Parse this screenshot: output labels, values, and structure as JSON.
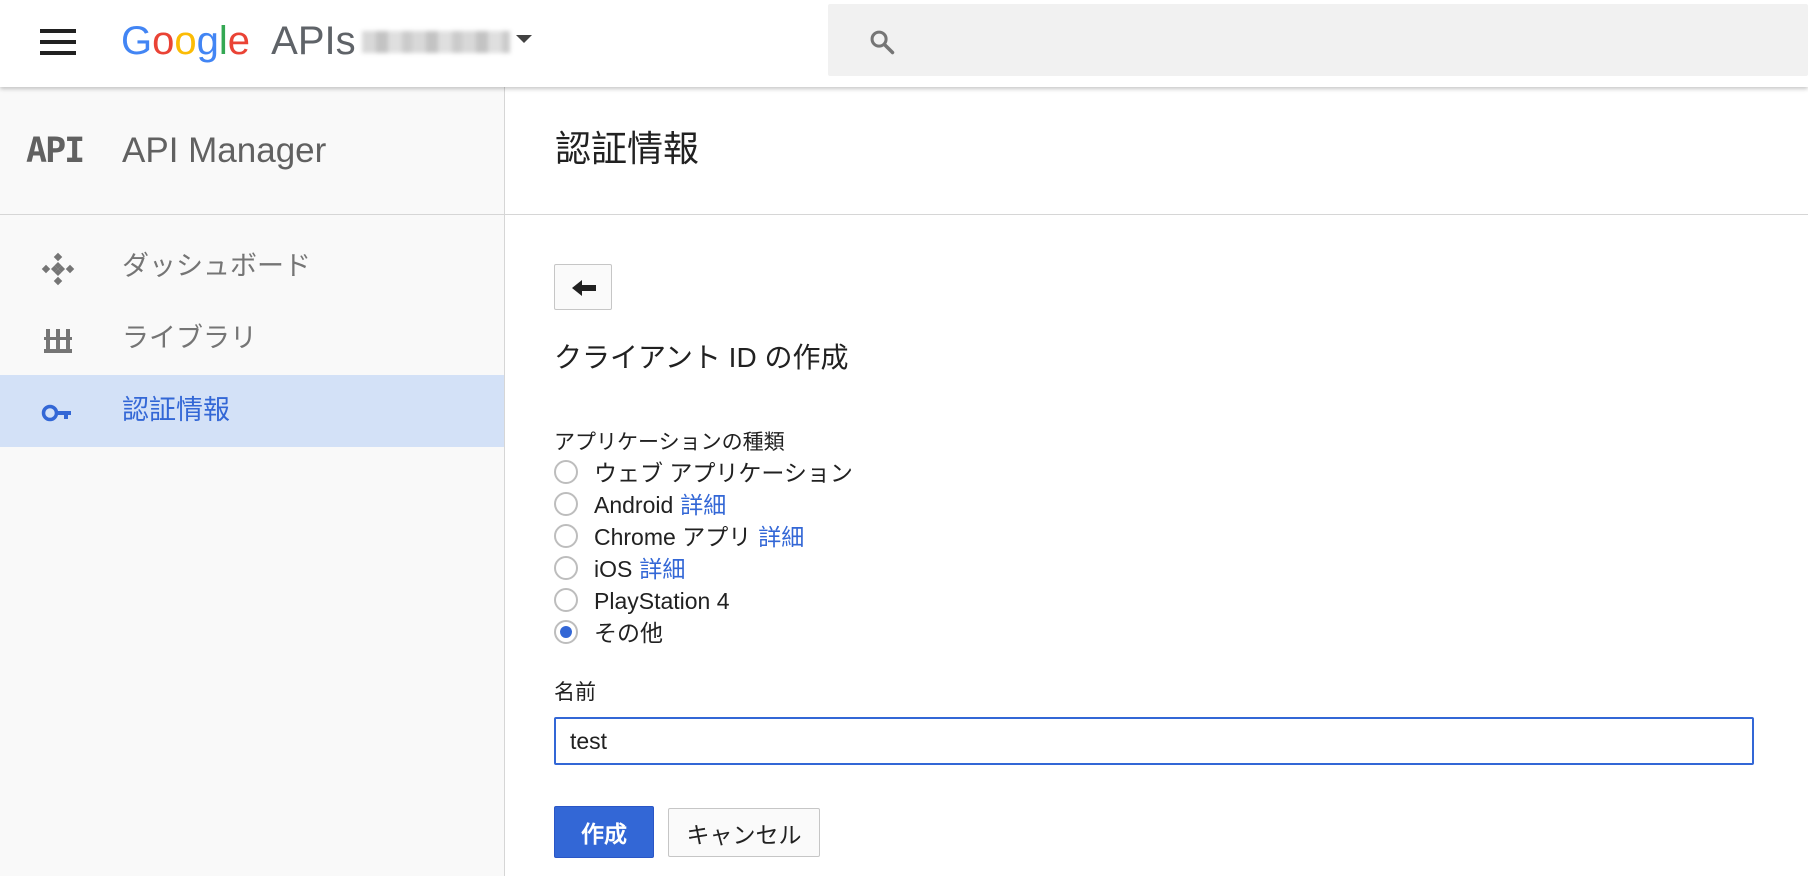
{
  "topbar": {
    "logo": {
      "google_letters": [
        {
          "ch": "G",
          "color": "#4285F4"
        },
        {
          "ch": "o",
          "color": "#EA4335"
        },
        {
          "ch": "o",
          "color": "#FBBC05"
        },
        {
          "ch": "g",
          "color": "#4285F4"
        },
        {
          "ch": "l",
          "color": "#34A853"
        },
        {
          "ch": "e",
          "color": "#EA4335"
        }
      ],
      "product": "APIs"
    },
    "search": {
      "placeholder": ""
    }
  },
  "sidebar": {
    "badge": "API",
    "title": "API Manager",
    "items": [
      {
        "label": "ダッシュボード",
        "icon": "dashboard-icon",
        "active": false
      },
      {
        "label": "ライブラリ",
        "icon": "library-icon",
        "active": false
      },
      {
        "label": "認証情報",
        "icon": "key-icon",
        "active": true
      }
    ]
  },
  "main": {
    "title": "認証情報",
    "section_title": "クライアント ID の作成",
    "app_type": {
      "label": "アプリケーションの種類",
      "options": [
        {
          "label": "ウェブ アプリケーション",
          "link": ""
        },
        {
          "label": "Android",
          "link": "詳細"
        },
        {
          "label": "Chrome アプリ",
          "link": "詳細"
        },
        {
          "label": "iOS",
          "link": "詳細"
        },
        {
          "label": "PlayStation 4",
          "link": ""
        },
        {
          "label": "その他",
          "link": ""
        }
      ],
      "selected_index": 5
    },
    "name": {
      "label": "名前",
      "value": "test"
    },
    "buttons": {
      "create": "作成",
      "cancel": "キャンセル"
    }
  },
  "colors": {
    "accent": "#3367d6",
    "active_nav_bg": "#d3e1f7",
    "sidebar_bg": "#f9f9f9",
    "search_bg": "#f1f1f1"
  }
}
